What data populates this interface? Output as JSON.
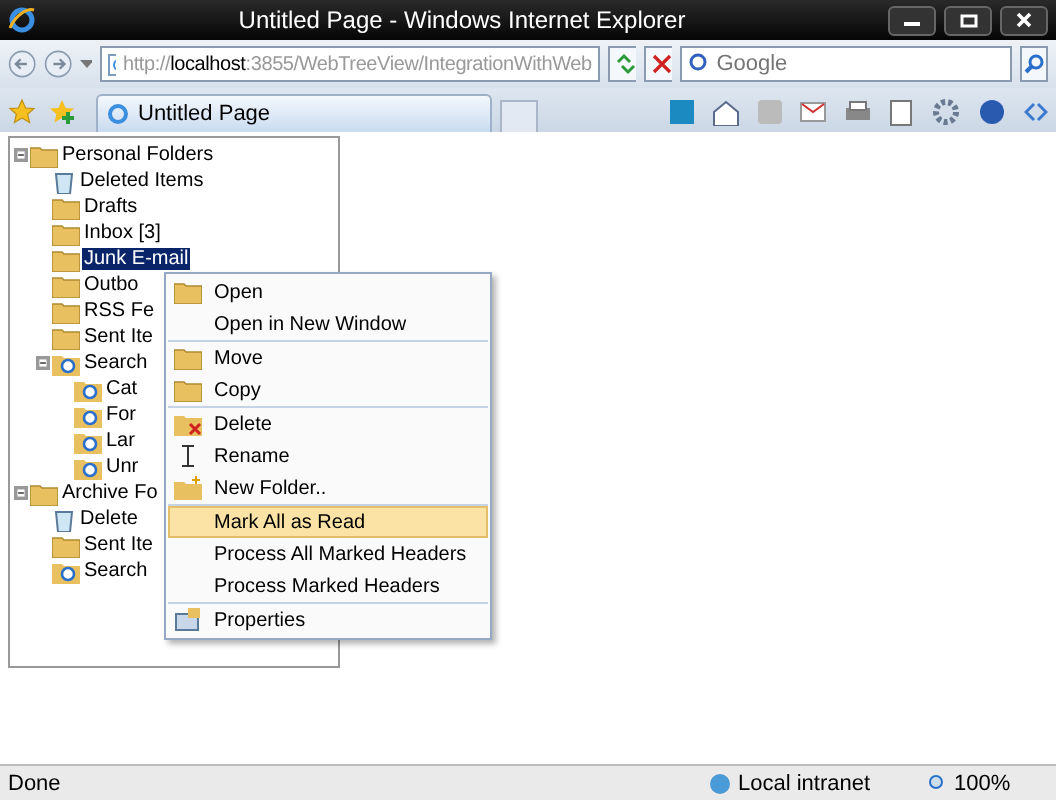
{
  "window": {
    "title": "Untitled Page - Windows Internet Explorer"
  },
  "address_bar": {
    "value": "http://**localhost**:3855/WebTreeView/IntegrationWithWeb"
  },
  "search": {
    "placeholder": "Google"
  },
  "tabs": [
    {
      "label": "Untitled Page",
      "selected": true
    }
  ],
  "tree": [
    {
      "label": "Personal Folders",
      "kind": "root",
      "selected": false,
      "expanded": true,
      "children": [
        {
          "label": "Deleted Items",
          "kind": "trash",
          "selected": false
        },
        {
          "label": "Drafts",
          "kind": "folder",
          "selected": false
        },
        {
          "label": "Inbox [3]",
          "kind": "folder",
          "selected": false
        },
        {
          "label": "Junk E-mail",
          "kind": "folder",
          "selected": true
        },
        {
          "label": "Outbo",
          "kind": "folder",
          "selected": false
        },
        {
          "label": "RSS Fe",
          "kind": "folder",
          "selected": false
        },
        {
          "label": "Sent Ite",
          "kind": "folder",
          "selected": false
        },
        {
          "label": "Search",
          "kind": "search",
          "selected": false,
          "expanded": true,
          "children": [
            {
              "label": "Cat",
              "kind": "search",
              "selected": false
            },
            {
              "label": "For",
              "kind": "search",
              "selected": false
            },
            {
              "label": "Lar",
              "kind": "search",
              "selected": false
            },
            {
              "label": "Unr",
              "kind": "search",
              "selected": false
            }
          ]
        }
      ]
    },
    {
      "label": "Archive Fo",
      "kind": "root",
      "selected": false,
      "expanded": true,
      "children": [
        {
          "label": "Delete",
          "kind": "trash",
          "selected": false
        },
        {
          "label": "Sent Ite",
          "kind": "folder",
          "selected": false
        },
        {
          "label": "Search",
          "kind": "search",
          "selected": false
        }
      ]
    }
  ],
  "context_menu": {
    "groups": [
      [
        {
          "label": "Open",
          "kind": "open",
          "selected": false
        },
        {
          "label": "Open in New Window",
          "kind": "plain",
          "selected": false
        }
      ],
      [
        {
          "label": "Move",
          "kind": "move",
          "selected": false
        },
        {
          "label": "Copy",
          "kind": "move",
          "selected": false
        }
      ],
      [
        {
          "label": "Delete",
          "kind": "delete",
          "selected": false
        },
        {
          "label": "Rename",
          "kind": "rename",
          "selected": false
        },
        {
          "label": "New Folder..",
          "kind": "new-folder",
          "selected": false
        }
      ],
      [
        {
          "label": "Mark All as Read",
          "kind": "plain",
          "selected": true
        },
        {
          "label": "Process All Marked Headers",
          "kind": "plain",
          "selected": false
        },
        {
          "label": "Process Marked Headers",
          "kind": "plain",
          "selected": false
        }
      ],
      [
        {
          "label": "Properties",
          "kind": "properties",
          "selected": false
        }
      ]
    ]
  },
  "status_bar": {
    "status": "Done",
    "zone": "Local intranet",
    "zoom": "100%"
  }
}
